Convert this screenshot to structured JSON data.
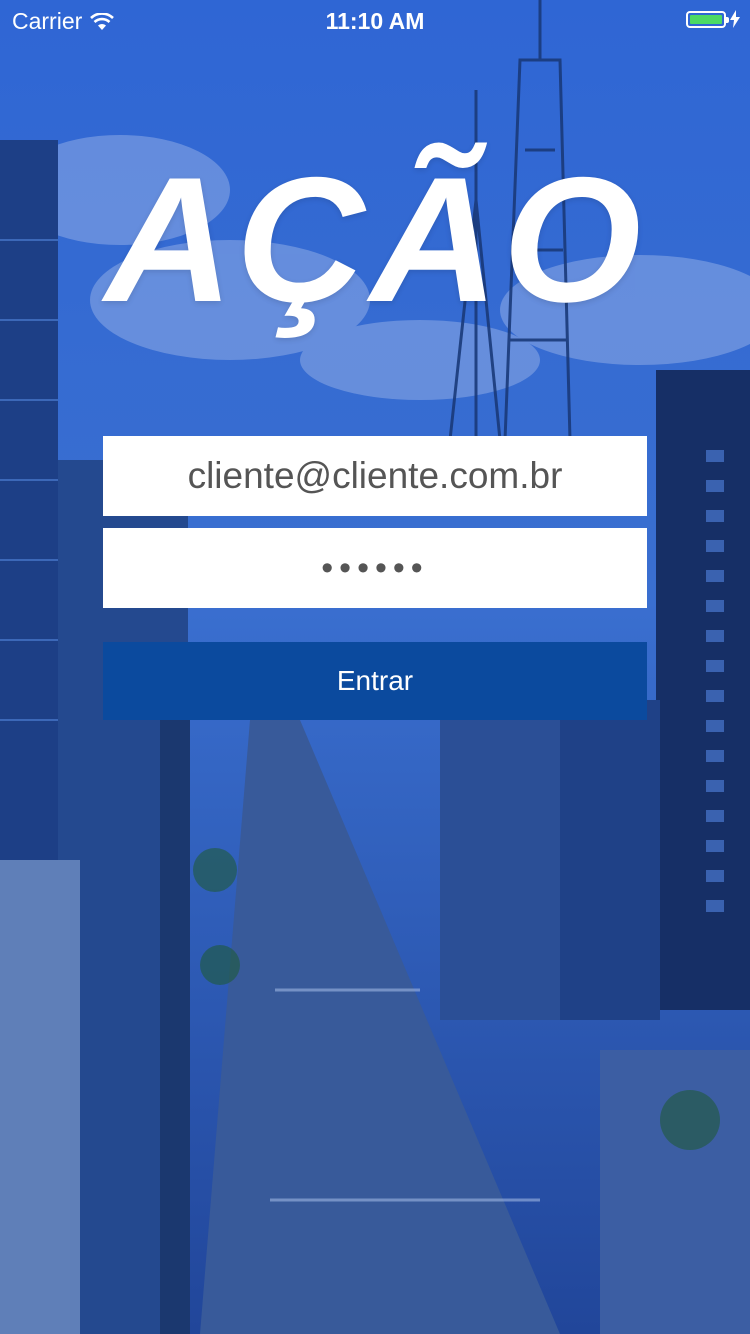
{
  "status_bar": {
    "carrier": "Carrier",
    "time": "11:10 AM",
    "battery_level": 1.0
  },
  "app": {
    "logo_text": "AÇÃO"
  },
  "login_form": {
    "email_value": "cliente@cliente.com.br",
    "password_value": "••••••",
    "submit_label": "Entrar"
  },
  "colors": {
    "overlay_blue": "#2d5fc4",
    "button_blue": "#0b4a9e",
    "battery_green": "#4cd964"
  }
}
